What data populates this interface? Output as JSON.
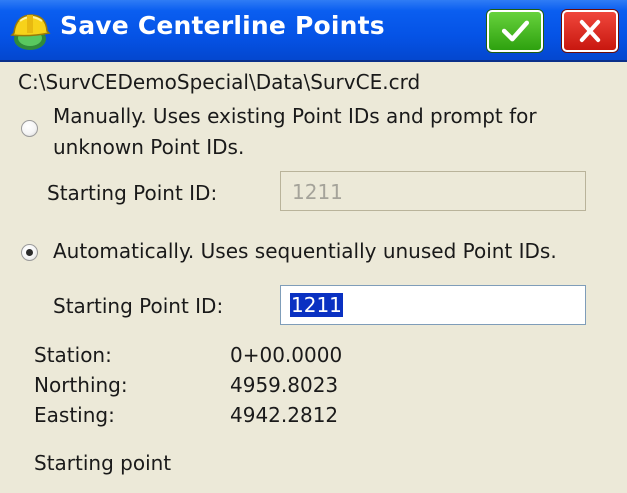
{
  "window": {
    "title": "Save Centerline Points",
    "ok_icon": "checkmark-icon",
    "cancel_icon": "close-icon",
    "app_icon": "surveyor-hardhat-icon"
  },
  "file_path": "C:\\SurvCEDemoSpecial\\Data\\SurvCE.crd",
  "manual_option": {
    "line1": "Manually. Uses existing Point IDs and prompt for",
    "line2": "unknown Point IDs.",
    "selected": false,
    "starting_label": "Starting Point ID:",
    "starting_value": "1211"
  },
  "auto_option": {
    "label": "Automatically. Uses sequentially unused Point IDs.",
    "selected": true,
    "starting_label": "Starting Point ID:",
    "starting_value": "1211"
  },
  "info": {
    "station_label": "Station:",
    "station_value": "0+00.0000",
    "northing_label": "Northing:",
    "northing_value": "4959.8023",
    "easting_label": "Easting:",
    "easting_value": "4942.2812"
  },
  "status": "Starting point",
  "colors": {
    "titlebar": "#0553e6",
    "ok_button": "#2ea10f",
    "cancel_button": "#c8170f",
    "background": "#ece9d8",
    "selection": "#0a31c2"
  }
}
